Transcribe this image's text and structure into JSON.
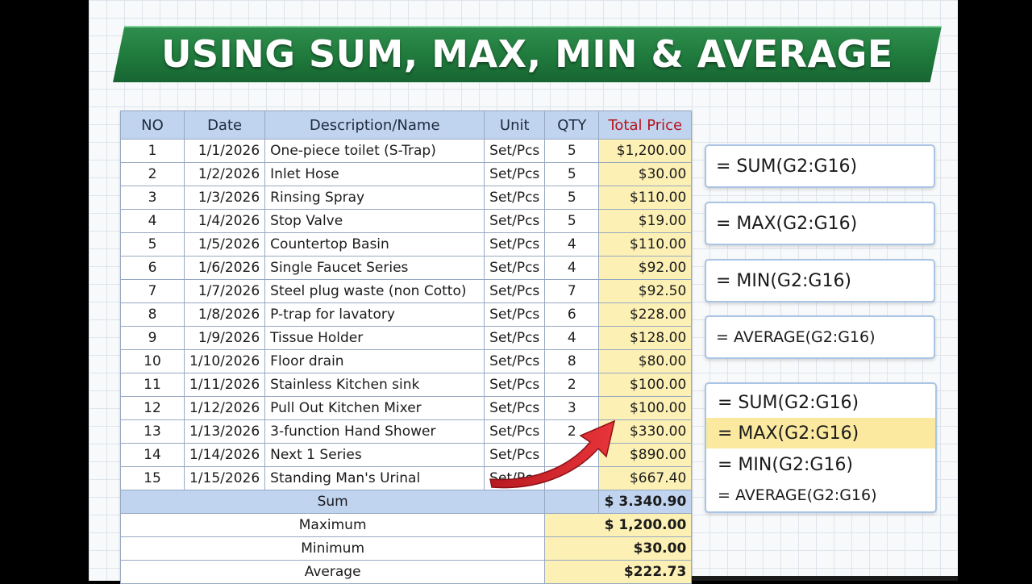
{
  "title": "USING SUM, MAX, MIN & AVERAGE",
  "table": {
    "headers": {
      "no": "NO",
      "date": "Date",
      "description": "Description/Name",
      "unit": "Unit",
      "qty": "QTY",
      "total": "Total Price"
    },
    "rows": [
      {
        "no": "1",
        "date": "1/1/2026",
        "description": "One-piece toilet (S-Trap)",
        "unit": "Set/Pcs",
        "qty": "5",
        "total": "$1,200.00"
      },
      {
        "no": "2",
        "date": "1/2/2026",
        "description": "Inlet Hose",
        "unit": "Set/Pcs",
        "qty": "5",
        "total": "$30.00"
      },
      {
        "no": "3",
        "date": "1/3/2026",
        "description": "Rinsing Spray",
        "unit": "Set/Pcs",
        "qty": "5",
        "total": "$110.00"
      },
      {
        "no": "4",
        "date": "1/4/2026",
        "description": "Stop Valve",
        "unit": "Set/Pcs",
        "qty": "5",
        "total": "$19.00"
      },
      {
        "no": "5",
        "date": "1/5/2026",
        "description": "Countertop Basin",
        "unit": "Set/Pcs",
        "qty": "4",
        "total": "$110.00"
      },
      {
        "no": "6",
        "date": "1/6/2026",
        "description": "Single Faucet Series",
        "unit": "Set/Pcs",
        "qty": "4",
        "total": "$92.00"
      },
      {
        "no": "7",
        "date": "1/7/2026",
        "description": "Steel plug waste (non Cotto)",
        "unit": "Set/Pcs",
        "qty": "7",
        "total": "$92.50"
      },
      {
        "no": "8",
        "date": "1/8/2026",
        "description": "P-trap for lavatory",
        "unit": "Set/Pcs",
        "qty": "6",
        "total": "$228.00"
      },
      {
        "no": "9",
        "date": "1/9/2026",
        "description": "Tissue Holder",
        "unit": "Set/Pcs",
        "qty": "4",
        "total": "$128.00"
      },
      {
        "no": "10",
        "date": "1/10/2026",
        "description": "Floor drain",
        "unit": "Set/Pcs",
        "qty": "8",
        "total": "$80.00"
      },
      {
        "no": "11",
        "date": "1/11/2026",
        "description": "Stainless Kitchen sink",
        "unit": "Set/Pcs",
        "qty": "2",
        "total": "$100.00"
      },
      {
        "no": "12",
        "date": "1/12/2026",
        "description": "Pull Out Kitchen Mixer",
        "unit": "Set/Pcs",
        "qty": "3",
        "total": "$100.00"
      },
      {
        "no": "13",
        "date": "1/13/2026",
        "description": "3-function Hand Shower",
        "unit": "Set/Pcs",
        "qty": "2",
        "total": "$330.00"
      },
      {
        "no": "14",
        "date": "1/14/2026",
        "description": "Next 1 Series",
        "unit": "Set/Pcs",
        "qty": "",
        "total": "$890.00"
      },
      {
        "no": "15",
        "date": "1/15/2026",
        "description": "Standing Man's Urinal",
        "unit": "Set/Pcs",
        "qty": "",
        "total": "$667.40"
      }
    ],
    "summary": {
      "sum_label": "Sum",
      "sum_value": "$ 3.340.90",
      "max_label": "Maximum",
      "max_value": "$ 1,200.00",
      "min_label": "Minimum",
      "min_value": "$30.00",
      "avg_label": "Average",
      "avg_value": "$222.73"
    }
  },
  "formulas": {
    "sum": "= SUM(G2:G16)",
    "max": "= MAX(G2:G16)",
    "min": "= MIN(G2:G16)",
    "average": "= AVERAGE(G2:G16)"
  },
  "formula_group": {
    "sum": "= SUM(G2:G16)",
    "max": "= MAX(G2:G16)",
    "min": "= MIN(G2:G16)",
    "average": "= AVERAGE(G2:G16)"
  },
  "colors": {
    "banner_green": "#1f7a3c",
    "header_blue": "#c0d4ef",
    "total_yellow": "#fcf0b4",
    "total_header_red": "#b5131d",
    "arrow_red": "#d8232a"
  },
  "icons": {
    "arrow": "red-curved-arrow-icon"
  }
}
